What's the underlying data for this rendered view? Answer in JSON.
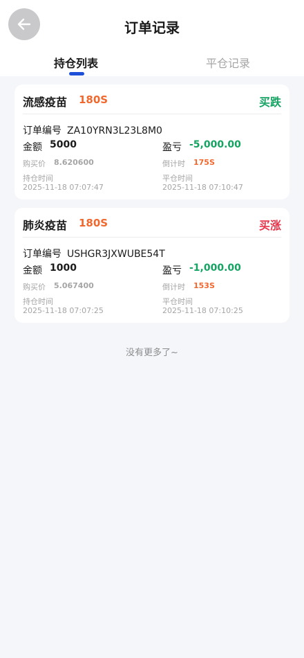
{
  "header": {
    "title": "订单记录",
    "back_icon": "arrow-left-icon"
  },
  "tabs": [
    {
      "label": "持仓列表",
      "active": true
    },
    {
      "label": "平仓记录",
      "active": false
    }
  ],
  "colors": {
    "accent_blue": "#1d4fd8",
    "profit_green": "#15a362",
    "up_red": "#e7344a",
    "orange": "#f0682e"
  },
  "labels": {
    "order_no": "订单编号",
    "amount": "金额",
    "pnl": "盈亏",
    "buy_price": "购买价",
    "countdown": "倒计时",
    "open_time": "持仓时间",
    "close_time": "平仓时间"
  },
  "orders": [
    {
      "product": "流感疫苗",
      "duration": "180S",
      "direction": "买跌",
      "order_no": "ZA10YRN3L23L8M0",
      "amount": "5000",
      "pnl": "-5,000.00",
      "buy_price": "8.620600",
      "countdown": "175S",
      "open_time": "2025-11-18 07:07:47",
      "close_time": "2025-11-18 07:10:47"
    },
    {
      "product": "肺炎疫苗",
      "duration": "180S",
      "direction": "买涨",
      "order_no": "USHGR3JXWUBE54T",
      "amount": "1000",
      "pnl": "-1,000.00",
      "buy_price": "5.067400",
      "countdown": "153S",
      "open_time": "2025-11-18 07:07:25",
      "close_time": "2025-11-18 07:10:25"
    }
  ],
  "footer": {
    "no_more": "没有更多了~"
  }
}
